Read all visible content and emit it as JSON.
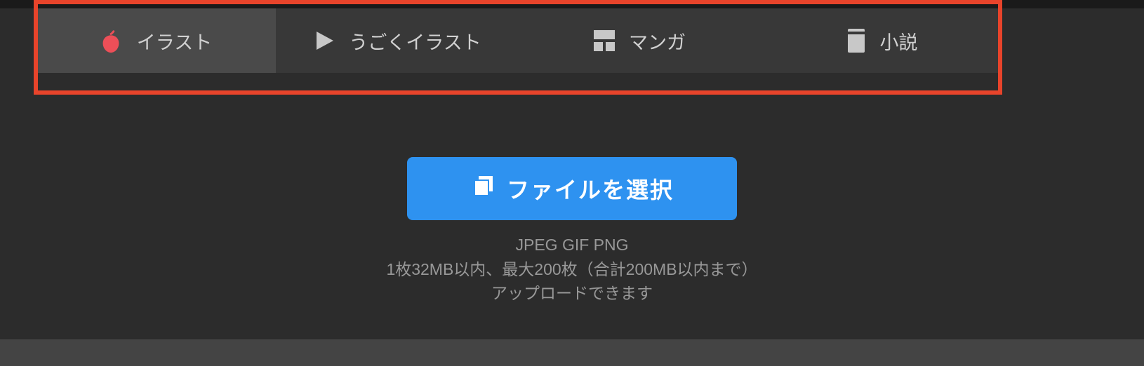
{
  "tabs": [
    {
      "label": "イラスト",
      "icon": "apple-icon",
      "active": true
    },
    {
      "label": "うごくイラスト",
      "icon": "play-icon",
      "active": false
    },
    {
      "label": "マンガ",
      "icon": "manga-icon",
      "active": false
    },
    {
      "label": "小説",
      "icon": "novel-icon",
      "active": false
    }
  ],
  "upload": {
    "button_label": "ファイルを選択",
    "formats": "JPEG GIF PNG",
    "limits": "1枚32MB以内、最大200枚（合計200MB以内まで）",
    "note": "アップロードできます"
  },
  "colors": {
    "accent": "#e8442b",
    "primary_button": "#2e92f0",
    "active_tab": "#4a4a4a"
  }
}
